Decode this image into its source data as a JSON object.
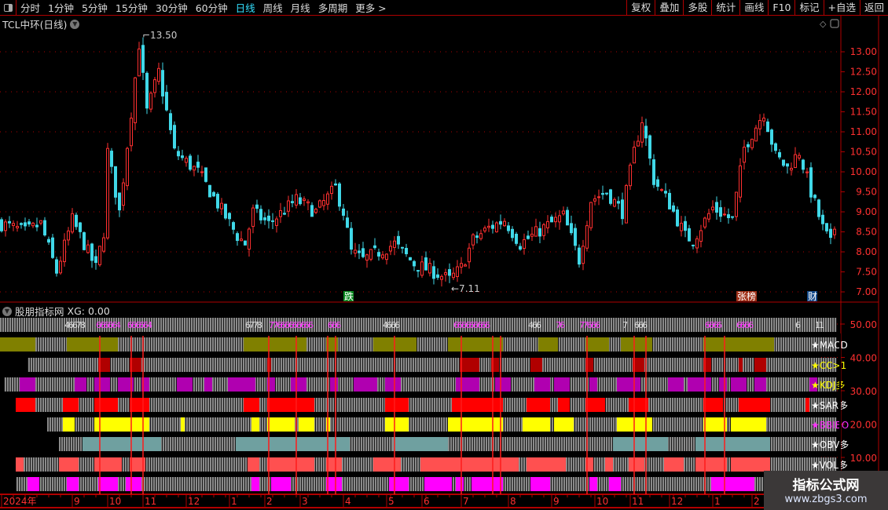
{
  "toolbar": {
    "periods": [
      "分时",
      "1分钟",
      "5分钟",
      "15分钟",
      "30分钟",
      "60分钟",
      "日线",
      "周线",
      "月线",
      "多周期",
      "更多 >"
    ],
    "active": "日线",
    "buttons": [
      "复权",
      "叠加",
      "多股",
      "统计",
      "画线",
      "F10",
      "标记",
      "+自选",
      "返回"
    ]
  },
  "chart": {
    "title": "TCL中环(日线)",
    "max_label": "13.50",
    "min_label": "7.11",
    "y_ticks": [
      "13.00",
      "12.50",
      "12.00",
      "11.50",
      "11.00",
      "10.50",
      "10.00",
      "9.50",
      "9.00",
      "8.50",
      "8.00",
      "7.50",
      "7.00"
    ],
    "tags": [
      {
        "text": "跌",
        "day": 87,
        "color": "#0a8a20"
      },
      {
        "text": "张榜",
        "day": 187,
        "color": "#a03018"
      },
      {
        "text": "财",
        "day": 205,
        "color": "#154a8a"
      }
    ],
    "colors": {
      "up": "#ff3030",
      "down": "#40d8e8",
      "axis": "#b00000"
    },
    "price_path": [
      [
        0,
        8.7
      ],
      [
        6,
        8.5
      ],
      [
        10,
        8.7
      ],
      [
        14,
        7.5
      ],
      [
        18,
        8.8
      ],
      [
        24,
        7.6
      ],
      [
        26,
        8.5
      ],
      [
        27,
        10.5
      ],
      [
        30,
        9.0
      ],
      [
        33,
        11.5
      ],
      [
        35,
        13.2
      ],
      [
        37,
        11.5
      ],
      [
        40,
        12.5
      ],
      [
        44,
        10.5
      ],
      [
        50,
        10.0
      ],
      [
        55,
        9.2
      ],
      [
        60,
        8.4
      ],
      [
        62,
        8.2
      ],
      [
        64,
        9.0
      ],
      [
        68,
        8.7
      ],
      [
        75,
        9.3
      ],
      [
        80,
        9.0
      ],
      [
        85,
        9.6
      ],
      [
        87,
        9.0
      ],
      [
        89,
        8.0
      ],
      [
        92,
        7.8
      ],
      [
        96,
        8.0
      ],
      [
        100,
        8.2
      ],
      [
        105,
        7.7
      ],
      [
        110,
        7.5
      ],
      [
        114,
        7.3
      ],
      [
        117,
        7.6
      ],
      [
        120,
        8.3
      ],
      [
        124,
        8.6
      ],
      [
        128,
        8.8
      ],
      [
        132,
        8.2
      ],
      [
        138,
        8.6
      ],
      [
        143,
        8.9
      ],
      [
        147,
        7.8
      ],
      [
        150,
        9.3
      ],
      [
        154,
        9.5
      ],
      [
        158,
        9.0
      ],
      [
        161,
        10.5
      ],
      [
        163,
        11.3
      ],
      [
        166,
        9.8
      ],
      [
        170,
        9.2
      ],
      [
        174,
        8.4
      ],
      [
        176,
        8.3
      ],
      [
        181,
        9.1
      ],
      [
        186,
        8.8
      ],
      [
        189,
        10.6
      ],
      [
        194,
        11.5
      ],
      [
        197,
        10.4
      ],
      [
        200,
        10.1
      ],
      [
        203,
        10.5
      ],
      [
        206,
        9.5
      ],
      [
        209,
        8.6
      ],
      [
        211,
        8.2
      ],
      [
        212,
        8.6
      ]
    ]
  },
  "indicator": {
    "title": "股朋指标网",
    "xg": "XG: 0.00",
    "y_ticks": [
      "50.00",
      "40.00",
      "30.00",
      "20.00",
      "10.00"
    ],
    "signal_days": [
      25,
      33,
      36,
      68,
      75,
      83,
      85,
      100,
      117,
      125,
      127,
      149,
      161,
      164,
      179,
      184
    ],
    "count_row": {
      "start": 0,
      "numbers": [
        {
          "day": 16,
          "text": "46678",
          "color": "#dddddd"
        },
        {
          "day": 24,
          "text": "666664",
          "color": "#ff40ff"
        },
        {
          "day": 32,
          "text": "666664",
          "color": "#ff40ff"
        },
        {
          "day": 62,
          "text": "6778",
          "color": "#dddddd"
        },
        {
          "day": 68,
          "text": "77666666666",
          "color": "#ff40ff"
        },
        {
          "day": 83,
          "text": "666",
          "color": "#ff40ff"
        },
        {
          "day": 97,
          "text": "4666",
          "color": "#dddddd"
        },
        {
          "day": 115,
          "text": "666666666",
          "color": "#ff40ff"
        },
        {
          "day": 134,
          "text": "466",
          "color": "#dddddd"
        },
        {
          "day": 141,
          "text": "76",
          "color": "#ff40ff"
        },
        {
          "day": 147,
          "text": "77666",
          "color": "#ff40ff"
        },
        {
          "day": 158,
          "text": "7",
          "color": "#dddddd"
        },
        {
          "day": 161,
          "text": "666",
          "color": "#dddddd"
        },
        {
          "day": 179,
          "text": "6666",
          "color": "#ff40ff"
        },
        {
          "day": 187,
          "text": "6666",
          "color": "#ff40ff"
        },
        {
          "day": 202,
          "text": "6",
          "color": "#dddddd"
        },
        {
          "day": 207,
          "text": "11",
          "color": "#dddddd"
        }
      ]
    },
    "rows": [
      {
        "label": "★MACD",
        "label_color": "#ffffff",
        "color": "#808000",
        "start": 0,
        "segments": [
          [
            0,
            9
          ],
          [
            17,
            30
          ],
          [
            62,
            78
          ],
          [
            83,
            86
          ],
          [
            95,
            106
          ],
          [
            114,
            128
          ],
          [
            137,
            142
          ],
          [
            149,
            155
          ],
          [
            158,
            166
          ],
          [
            179,
            197
          ]
        ]
      },
      {
        "label": "★CC>1",
        "label_color": "#ffff00",
        "color": "#b00000",
        "start": 7,
        "segments": [
          [
            25,
            28
          ],
          [
            33,
            36
          ],
          [
            68,
            69
          ],
          [
            117,
            122
          ],
          [
            125,
            127
          ],
          [
            135,
            138
          ],
          [
            149,
            151
          ],
          [
            161,
            164
          ],
          [
            179,
            181
          ],
          [
            188,
            189
          ],
          [
            192,
            195
          ]
        ]
      },
      {
        "label": "★KDJ多",
        "label_color": "#ffff00",
        "color": "#b000b0",
        "start": 1,
        "segments": [
          [
            5,
            9
          ],
          [
            19,
            22
          ],
          [
            24,
            28
          ],
          [
            30,
            34
          ],
          [
            36,
            38
          ],
          [
            45,
            49
          ],
          [
            52,
            54
          ],
          [
            58,
            65
          ],
          [
            68,
            70
          ],
          [
            74,
            78
          ],
          [
            84,
            86
          ],
          [
            90,
            96
          ],
          [
            98,
            102
          ],
          [
            116,
            122
          ],
          [
            126,
            130
          ],
          [
            136,
            140
          ],
          [
            141,
            145
          ],
          [
            150,
            152
          ],
          [
            157,
            163
          ],
          [
            170,
            174
          ],
          [
            175,
            181
          ],
          [
            183,
            185
          ],
          [
            186,
            190
          ],
          [
            192,
            195
          ],
          [
            206,
            208
          ]
        ]
      },
      {
        "label": "★SAR多",
        "label_color": "#ffffff",
        "color": "#ff0000",
        "start": 4,
        "segments": [
          [
            4,
            9
          ],
          [
            16,
            20
          ],
          [
            24,
            30
          ],
          [
            33,
            38
          ],
          [
            62,
            66
          ],
          [
            68,
            80
          ],
          [
            98,
            104
          ],
          [
            115,
            128
          ],
          [
            134,
            140
          ],
          [
            142,
            145
          ],
          [
            149,
            154
          ],
          [
            160,
            165
          ],
          [
            179,
            184
          ],
          [
            188,
            196
          ],
          [
            205,
            206
          ]
        ]
      },
      {
        "label": "★BBIBO",
        "label_color": "#ff30ff",
        "color": "#ffff00",
        "start": 12,
        "segments": [
          [
            16,
            19
          ],
          [
            24,
            38
          ],
          [
            46,
            47
          ],
          [
            64,
            66
          ],
          [
            68,
            75
          ],
          [
            76,
            80
          ],
          [
            83,
            84
          ],
          [
            98,
            104
          ],
          [
            114,
            128
          ],
          [
            133,
            140
          ],
          [
            141,
            146
          ],
          [
            157,
            166
          ],
          [
            179,
            185
          ],
          [
            186,
            195
          ]
        ]
      },
      {
        "label": "★OBV多",
        "label_color": "#ffffff",
        "color": "#6fa0a0",
        "start": 15,
        "segments": [
          [
            21,
            41
          ],
          [
            60,
            89
          ],
          [
            100,
            114
          ],
          [
            156,
            170
          ],
          [
            177,
            196
          ]
        ]
      },
      {
        "label": "★VOL多",
        "label_color": "#ffffff",
        "color": "#ff5050",
        "start": 4,
        "segments": [
          [
            4,
            6
          ],
          [
            15,
            20
          ],
          [
            24,
            31
          ],
          [
            33,
            37
          ],
          [
            63,
            66
          ],
          [
            68,
            80
          ],
          [
            83,
            87
          ],
          [
            95,
            102
          ],
          [
            107,
            132
          ],
          [
            134,
            144
          ],
          [
            149,
            151
          ],
          [
            154,
            156
          ],
          [
            160,
            164
          ],
          [
            169,
            174
          ],
          [
            177,
            185
          ],
          [
            186,
            196
          ]
        ]
      },
      {
        "label": "",
        "label_color": "#ffffff",
        "color": "#ff00ff",
        "start": 4,
        "segments": [
          [
            7,
            10
          ],
          [
            17,
            20
          ],
          [
            25,
            30
          ],
          [
            32,
            36
          ],
          [
            64,
            66
          ],
          [
            69,
            74
          ],
          [
            83,
            87
          ],
          [
            99,
            104
          ],
          [
            108,
            115
          ],
          [
            116,
            118
          ],
          [
            120,
            128
          ],
          [
            135,
            140
          ],
          [
            150,
            152
          ],
          [
            155,
            158
          ],
          [
            181,
            192
          ],
          [
            198,
            200
          ],
          [
            207,
            212
          ]
        ]
      }
    ]
  },
  "date_axis": [
    {
      "label": "2024年",
      "day": 0
    },
    {
      "label": "9",
      "day": 18
    },
    {
      "label": "10",
      "day": 27
    },
    {
      "label": "11",
      "day": 36
    },
    {
      "label": "12",
      "day": 47
    },
    {
      "label": "1",
      "day": 58
    },
    {
      "label": "2",
      "day": 67
    },
    {
      "label": "3",
      "day": 76
    },
    {
      "label": "4",
      "day": 87
    },
    {
      "label": "5",
      "day": 98
    },
    {
      "label": "6",
      "day": 107
    },
    {
      "label": "7",
      "day": 117
    },
    {
      "label": "8",
      "day": 129
    },
    {
      "label": "9",
      "day": 140
    },
    {
      "label": "10",
      "day": 151
    },
    {
      "label": "11",
      "day": 160
    },
    {
      "label": "12",
      "day": 170
    },
    {
      "label": "1",
      "day": 181
    },
    {
      "label": "2",
      "day": 191
    }
  ],
  "watermark": {
    "title": "指标公式网",
    "url": "www.zbgs3.com"
  }
}
